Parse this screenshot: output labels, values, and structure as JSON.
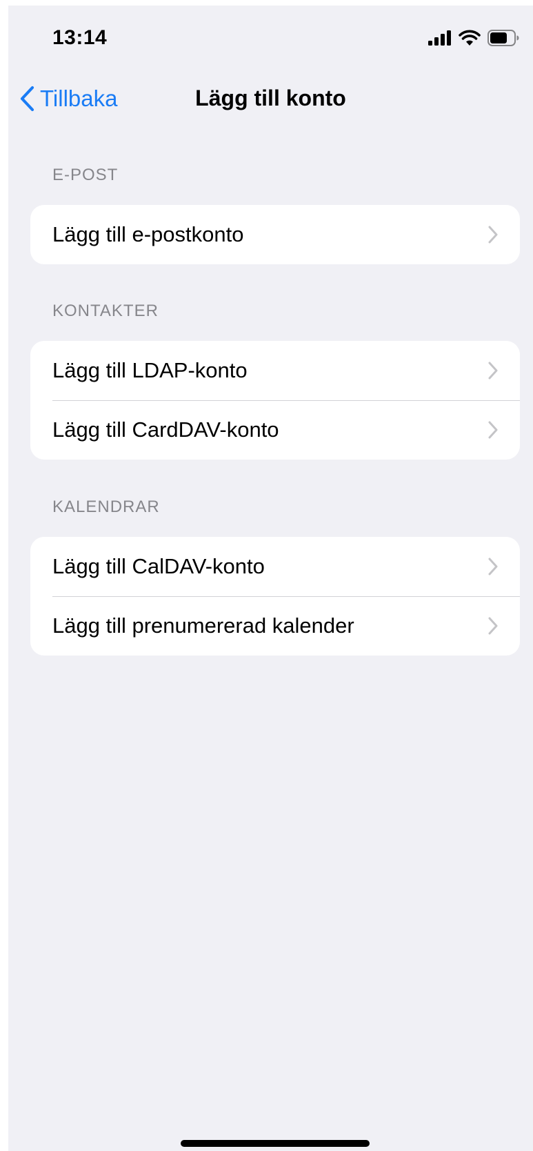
{
  "status_bar": {
    "time": "13:14",
    "icons": [
      "cellular-signal-icon",
      "wifi-icon",
      "battery-icon"
    ]
  },
  "nav": {
    "back_label": "Tillbaka",
    "title": "Lägg till konto"
  },
  "sections": [
    {
      "header": "E-POST",
      "items": [
        {
          "label": "Lägg till e-postkonto"
        }
      ]
    },
    {
      "header": "KONTAKTER",
      "items": [
        {
          "label": "Lägg till LDAP-konto"
        },
        {
          "label": "Lägg till CardDAV-konto"
        }
      ]
    },
    {
      "header": "KALENDRAR",
      "items": [
        {
          "label": "Lägg till CalDAV-konto"
        },
        {
          "label": "Lägg till prenumererad kalender"
        }
      ]
    }
  ],
  "colors": {
    "accent": "#1a7cf5",
    "background": "#f0f0f5",
    "section_header": "#86868b"
  }
}
